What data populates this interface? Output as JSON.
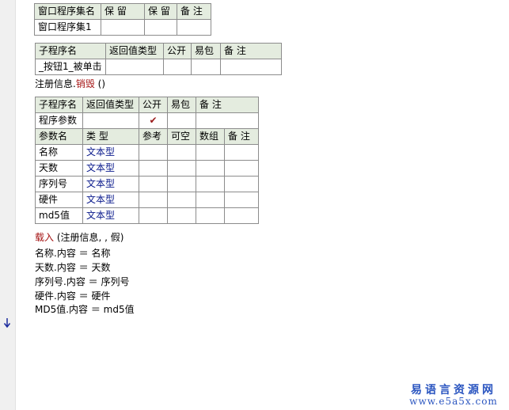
{
  "table1": {
    "header": [
      "窗口程序集名",
      "保 留",
      "保 留",
      "备 注"
    ],
    "row": [
      "窗口程序集1",
      "",
      "",
      ""
    ]
  },
  "table2": {
    "header": [
      "子程序名",
      "返回值类型",
      "公开",
      "易包",
      "备 注"
    ],
    "row": [
      "_按钮1_被单击",
      "",
      "",
      "",
      ""
    ]
  },
  "destroy_line": {
    "prefix": "注册信息.",
    "method": "销毁",
    "suffix": " ()"
  },
  "table3": {
    "header": [
      "子程序名",
      "返回值类型",
      "公开",
      "易包",
      "备 注"
    ],
    "sub_row": [
      "程序参数",
      "",
      "✔",
      "",
      ""
    ],
    "param_header": [
      "参数名",
      "类 型",
      "参考",
      "可空",
      "数组",
      "备 注"
    ],
    "params": [
      {
        "name": "名称",
        "type": "文本型"
      },
      {
        "name": "天数",
        "type": "文本型"
      },
      {
        "name": "序列号",
        "type": "文本型"
      },
      {
        "name": "硬件",
        "type": "文本型"
      },
      {
        "name": "md5值",
        "type": "文本型"
      }
    ]
  },
  "load_line": {
    "keyword": "载入",
    "args": " (注册信息, , 假)"
  },
  "code_lines": [
    "名称.内容 ＝ 名称",
    "天数.内容 ＝ 天数",
    "序列号.内容 ＝ 序列号",
    "硬件.内容 ＝ 硬件",
    "MD5值.内容 ＝ md5值"
  ],
  "watermark": {
    "line1": "易语言资源网",
    "line2": "www.e5a5x.com"
  },
  "colors": {
    "header_bg": "#e4ecdf",
    "type_text": "#0a1a8c",
    "keyword_red": "#a51414",
    "watermark": "#2a55c0"
  },
  "icons": [
    "down-arrow-icon",
    "checkmark-icon"
  ]
}
